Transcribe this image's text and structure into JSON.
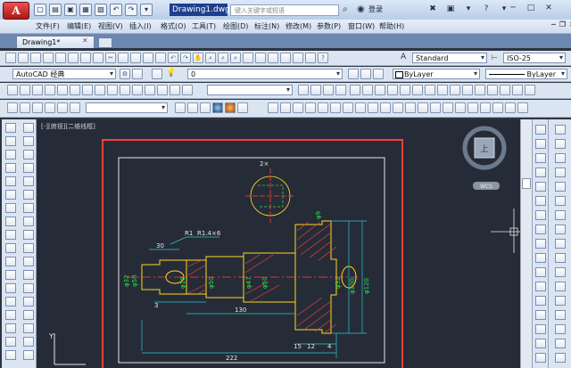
{
  "app": {
    "logo": "A",
    "document_title": "Drawing1.dwg",
    "search_placeholder": "键入关键字或短语",
    "login": "登录"
  },
  "menu": [
    "文件(F)",
    "编辑(E)",
    "视图(V)",
    "插入(I)",
    "格式(O)",
    "工具(T)",
    "绘图(D)",
    "标注(N)",
    "修改(M)",
    "参数(P)",
    "窗口(W)",
    "帮助(H)"
  ],
  "tabs": {
    "active": "Drawing1*"
  },
  "toolbar": {
    "text_style": "Standard",
    "dim_style": "ISO-25",
    "workspace": "AutoCAD 经典",
    "layer": "0",
    "color": "ByLayer",
    "linetype": "ByLayer",
    "empty_combo": ""
  },
  "viewport": {
    "label": "[-][俯视][二维线框]",
    "wcs": "WCS",
    "viewcube": "上"
  },
  "drawing": {
    "dims": [
      "2×",
      "R1",
      "R1.4×6",
      "30",
      "3",
      "130",
      "222",
      "15",
      "12",
      "4",
      "φ32",
      "φ50",
      "φ100",
      "φ120",
      "φ32",
      "φ18",
      "φ50",
      "φ47",
      "φ50",
      "φ9"
    ]
  },
  "colors": {
    "canvas": "#262c37",
    "red_frame": "#ff3b3b",
    "cyan": "#27c6d4",
    "green": "#2ddc4b",
    "yellow": "#ffd71f",
    "white": "#e6e6e6",
    "accent": "#1f3f8c"
  }
}
